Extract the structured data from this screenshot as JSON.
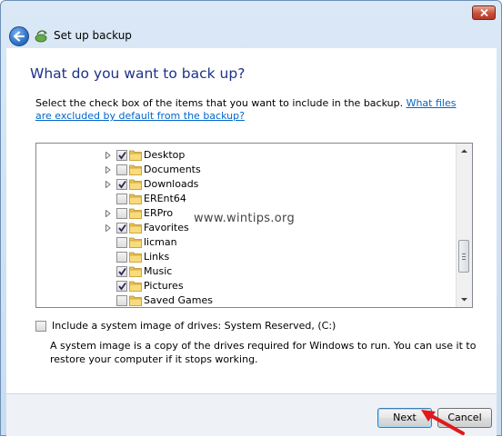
{
  "window": {
    "title": "Set up backup"
  },
  "content": {
    "heading": "What do you want to back up?",
    "instruction": "Select the check box of the items that you want to include in the backup.",
    "excluded_link": "What files are excluded by default from the backup?"
  },
  "tree": {
    "items": [
      {
        "label": "Desktop",
        "checked": true,
        "expandable": true
      },
      {
        "label": "Documents",
        "checked": false,
        "expandable": true
      },
      {
        "label": "Downloads",
        "checked": true,
        "expandable": true
      },
      {
        "label": "EREnt64",
        "checked": false,
        "expandable": false
      },
      {
        "label": "ERPro",
        "checked": false,
        "expandable": true
      },
      {
        "label": "Favorites",
        "checked": true,
        "expandable": true
      },
      {
        "label": "licman",
        "checked": false,
        "expandable": false
      },
      {
        "label": "Links",
        "checked": false,
        "expandable": false
      },
      {
        "label": "Music",
        "checked": true,
        "expandable": false
      },
      {
        "label": "Pictures",
        "checked": true,
        "expandable": false
      },
      {
        "label": "Saved Games",
        "checked": false,
        "expandable": false
      }
    ]
  },
  "watermark": "www.wintips.org",
  "system_image": {
    "checked": false,
    "label": "Include a system image of drives: System Reserved, (C:)",
    "description": "A system image is a copy of the drives required for Windows to run. You can use it to restore your computer if it stops working."
  },
  "buttons": {
    "next": "Next",
    "cancel": "Cancel"
  },
  "colors": {
    "heading": "#1e3287",
    "link": "#0066cc",
    "arrow": "#e0191b",
    "close_button": "#c7503a"
  }
}
